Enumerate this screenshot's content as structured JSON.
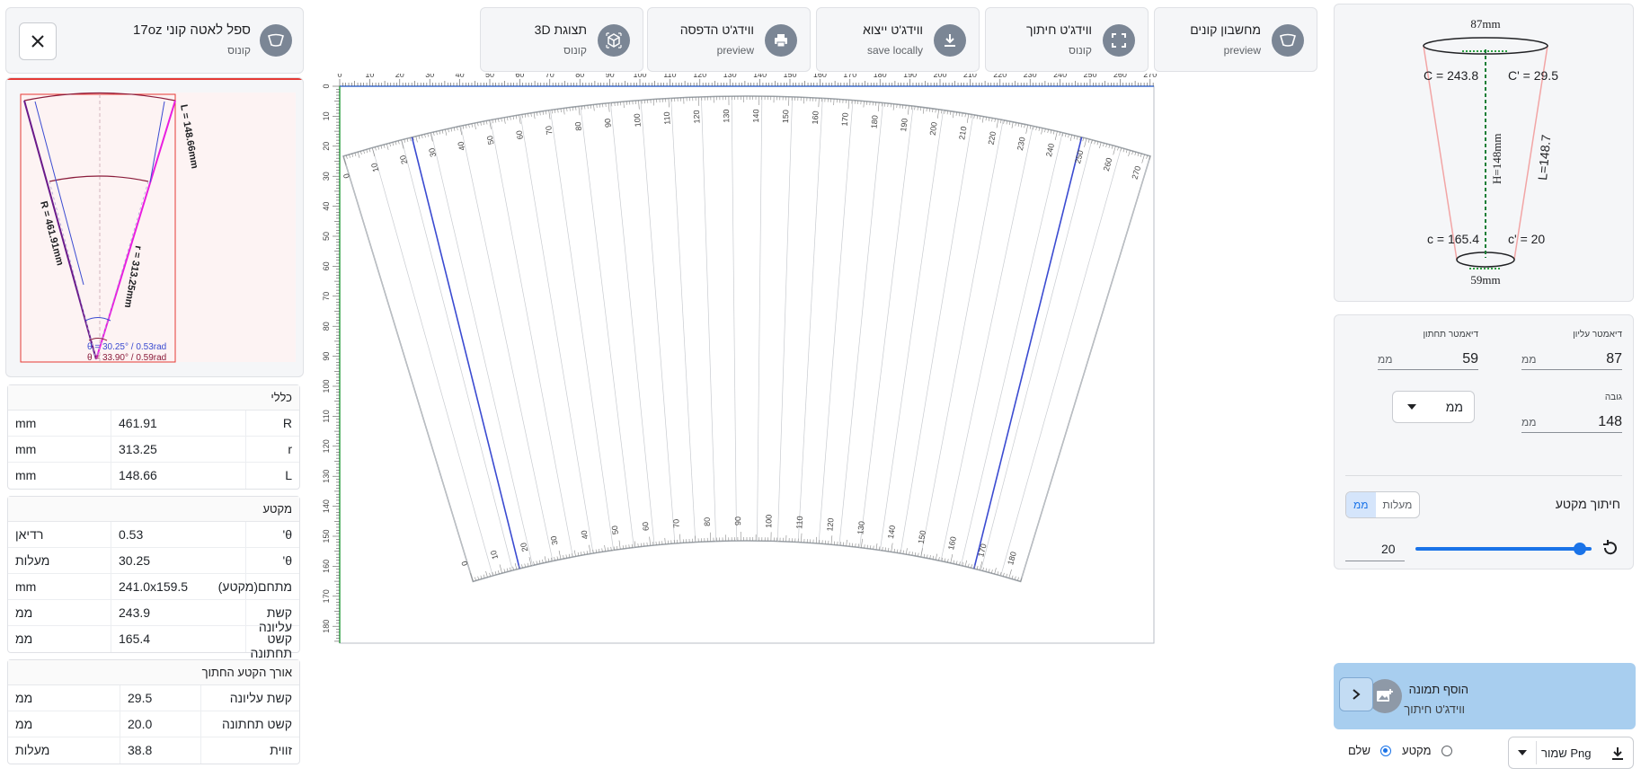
{
  "colors": {
    "accent": "#1a73e8",
    "add_image_bg": "#a8ceef",
    "icon_bg": "#7b8695"
  },
  "header": {
    "title": "17oz ספל לאטה קוני",
    "subtitle": "קונוס",
    "icon": "cone-icon",
    "close_icon": "close-icon"
  },
  "tabs": [
    {
      "title": "מחשבון קונים",
      "subtitle": "preview",
      "icon": "cone-icon"
    },
    {
      "title": "ווידג'ט חיתוך",
      "subtitle": "קונוס",
      "icon": "fullscreen-icon"
    },
    {
      "title": "ווידג'ט ייצוא",
      "subtitle": "save locally",
      "icon": "download-icon"
    },
    {
      "title": "ווידג'ט הדפסה",
      "subtitle": "preview",
      "icon": "print-icon"
    },
    {
      "title": "תצוגת 3D",
      "subtitle": "קונוס",
      "icon": "cube-3d-icon"
    }
  ],
  "preview": {
    "labels": {
      "L": "L = 148.66mm",
      "R": "R = 461.91mm",
      "r": "r = 313.25mm",
      "theta1": "θ = 30.25° / 0.53rad",
      "theta2": "θ = 33.90° / 0.59rad"
    }
  },
  "tables": {
    "general": {
      "title": "כללי",
      "rows": [
        {
          "label": "R",
          "value": "461.91",
          "unit": "mm"
        },
        {
          "label": "r",
          "value": "313.25",
          "unit": "mm"
        },
        {
          "label": "L",
          "value": "148.66",
          "unit": "mm"
        }
      ]
    },
    "section": {
      "title": "מקטע",
      "rows": [
        {
          "label": "θ'",
          "value": "0.53",
          "unit": "רדיאן"
        },
        {
          "label": "θ'",
          "value": "30.25",
          "unit": "מעלות"
        },
        {
          "label": "מתחם(מקטע)",
          "value": "241.0x159.5",
          "unit": "mm"
        },
        {
          "label": "קשת עליונה",
          "value": "243.9",
          "unit": "ממ"
        },
        {
          "label": "קשט תחתונה",
          "value": "165.4",
          "unit": "ממ"
        }
      ]
    },
    "cut": {
      "title": "אורך הקטע החתוך",
      "rows": [
        {
          "label": "קשת עליונה",
          "value": "29.5",
          "unit": "ממ"
        },
        {
          "label": "קשט תחתונה",
          "value": "20.0",
          "unit": "ממ"
        },
        {
          "label": "זווית",
          "value": "38.8",
          "unit": "מעלות"
        }
      ]
    }
  },
  "ruler": {
    "top_ticks": [
      "0",
      "10",
      "20",
      "30",
      "40",
      "50",
      "60",
      "70",
      "80",
      "90",
      "100",
      "110",
      "120",
      "130",
      "140",
      "150",
      "160",
      "170",
      "180",
      "190",
      "200",
      "210",
      "220",
      "230",
      "240",
      "250",
      "260",
      "270"
    ],
    "left_ticks": [
      "0",
      "10",
      "20",
      "30",
      "40",
      "50",
      "60",
      "70",
      "80",
      "90",
      "100",
      "110",
      "120",
      "130",
      "140",
      "150",
      "160",
      "170",
      "180"
    ],
    "outer_arc_ticks": [
      "0",
      "10",
      "20",
      "30",
      "40",
      "50",
      "60",
      "70",
      "80",
      "90",
      "100",
      "110",
      "120",
      "130",
      "140",
      "150",
      "160",
      "170",
      "180",
      "190",
      "200",
      "210",
      "220",
      "230",
      "240",
      "250",
      "260",
      "270"
    ],
    "inner_arc_ticks": [
      "0",
      "10",
      "20",
      "30",
      "40",
      "50",
      "60",
      "70",
      "80",
      "90",
      "100",
      "110",
      "120",
      "130",
      "140",
      "150",
      "160",
      "170",
      "180"
    ]
  },
  "diagram": {
    "top_diameter": "87mm",
    "bottom_diameter": "59mm",
    "C": "C = 243.8",
    "C_prime": "C' = 29.5",
    "H": "H=148mm",
    "L": "L=148.7",
    "c": "c = 165.4",
    "c_prime": "c' = 20"
  },
  "form": {
    "top_diameter": {
      "label": "דיאמטר עליון",
      "value": "87",
      "unit": "ממ"
    },
    "bottom_diameter": {
      "label": "דיאמטר תחתון",
      "value": "59",
      "unit": "ממ"
    },
    "height": {
      "label": "גובה",
      "value": "148",
      "unit": "ממ"
    },
    "unit_select": "ממ",
    "cut_label": "חיתוך מקטע",
    "cut_unit_degrees": "מעלות",
    "cut_unit_mm": "ממ",
    "cut_value": "20",
    "cut_slider_fraction": 0.9,
    "reset_icon": "reset-icon"
  },
  "add_image": {
    "title": "הוסף תמונה",
    "subtitle": "ווידג'ט חיתוך",
    "icon": "add-image-icon",
    "chevron": "chevron-right-icon"
  },
  "bottom": {
    "save_label": "שמור Png",
    "option_section": "מקטע",
    "option_full": "שלם",
    "selected": "שלם"
  }
}
